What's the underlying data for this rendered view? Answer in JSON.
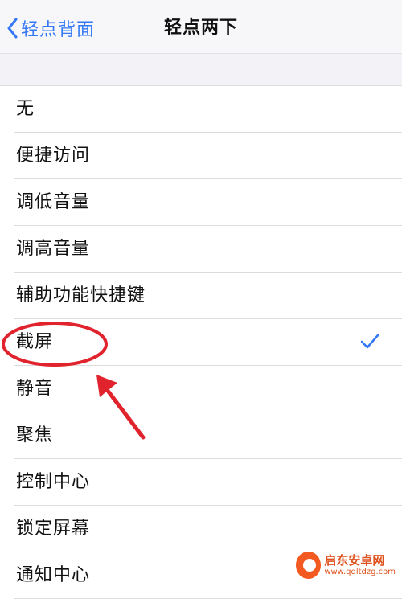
{
  "nav": {
    "back_label": "轻点背面",
    "title": "轻点两下"
  },
  "options": [
    {
      "label": "无",
      "selected": false
    },
    {
      "label": "便捷访问",
      "selected": false
    },
    {
      "label": "调低音量",
      "selected": false
    },
    {
      "label": "调高音量",
      "selected": false
    },
    {
      "label": "辅助功能快捷键",
      "selected": false
    },
    {
      "label": "截屏",
      "selected": true
    },
    {
      "label": "静音",
      "selected": false
    },
    {
      "label": "聚焦",
      "selected": false
    },
    {
      "label": "控制中心",
      "selected": false
    },
    {
      "label": "锁定屏幕",
      "selected": false
    },
    {
      "label": "通知中心",
      "selected": false
    }
  ],
  "icons": {
    "back": "chevron-left-icon",
    "selected": "checkmark-icon"
  },
  "colors": {
    "accent": "#3478f6",
    "annotation": "#e0232c",
    "watermark": "#e0531f"
  },
  "watermark": {
    "title": "启东安卓网",
    "url": "www.qdltdzg.com"
  }
}
